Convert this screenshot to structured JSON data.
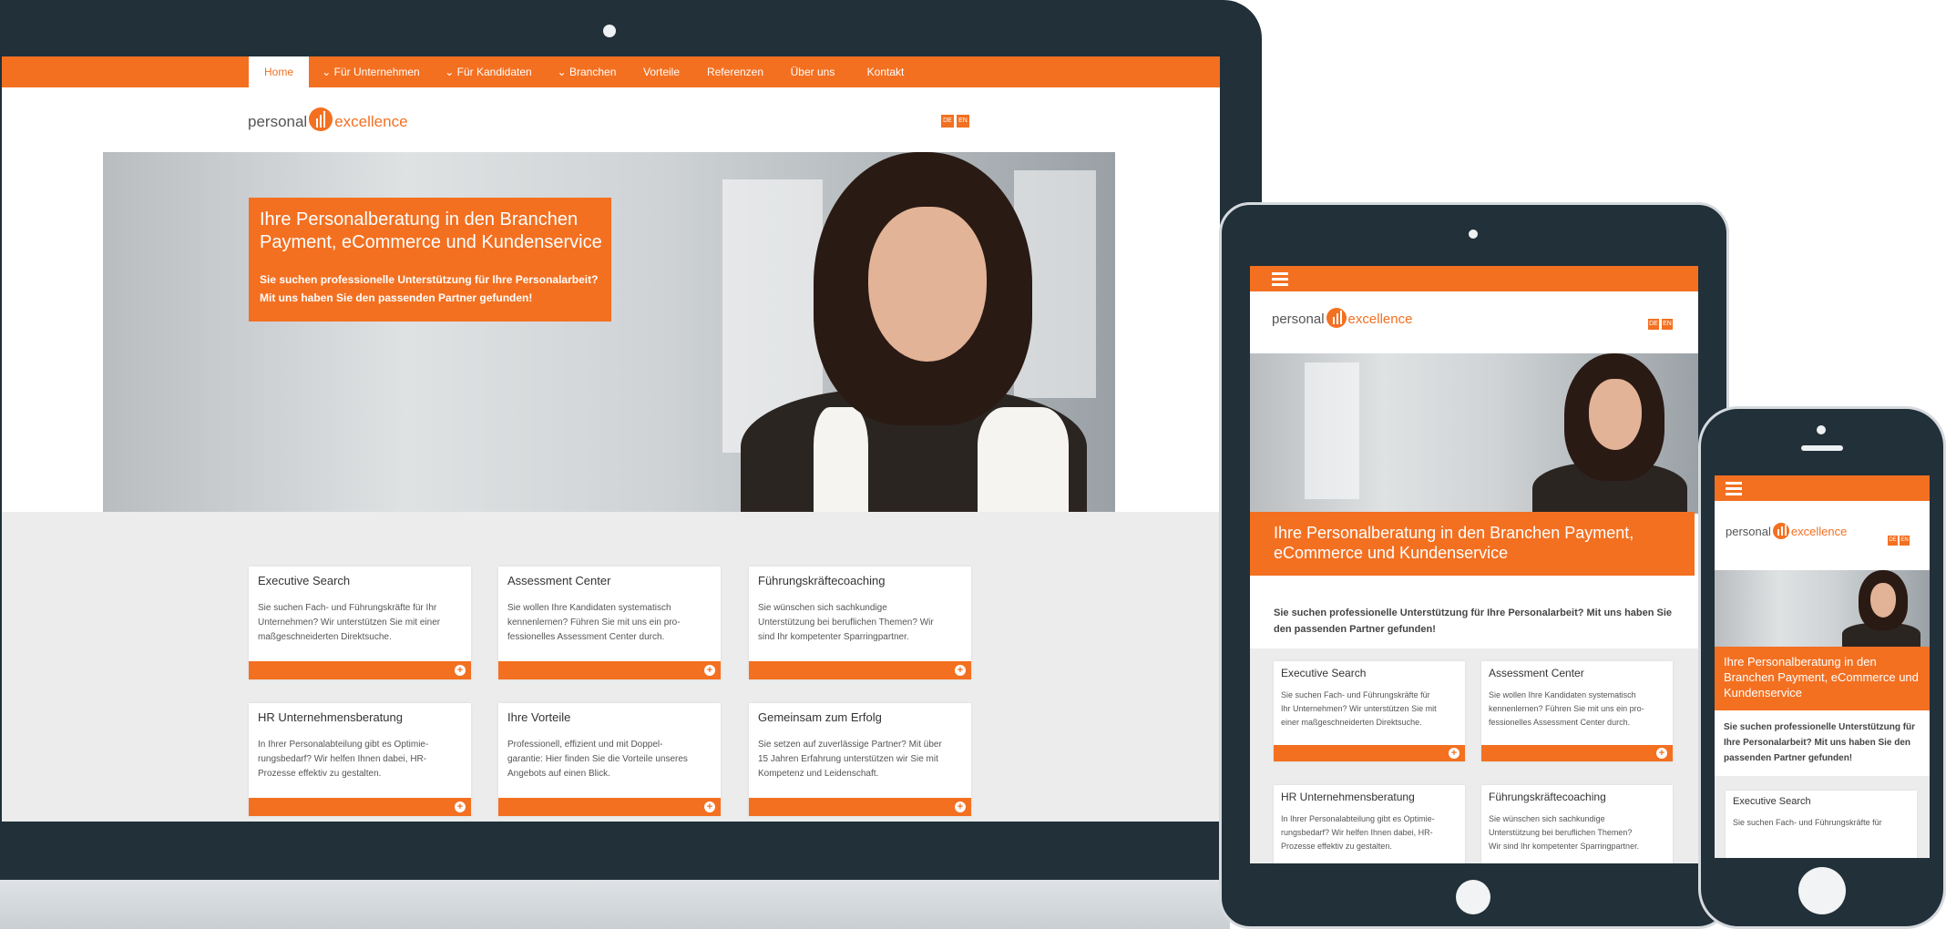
{
  "brand": {
    "part1": "personal",
    "part2": "excellence"
  },
  "languages": [
    "DE",
    "EN"
  ],
  "nav": [
    "Home",
    "Für Unternehmen",
    "Für Kandidaten",
    "Branchen",
    "Vorteile",
    "Referenzen",
    "Über uns",
    "Kontakt"
  ],
  "nav_dropdown_flags": [
    false,
    true,
    true,
    true,
    false,
    false,
    false,
    false
  ],
  "hero": {
    "title_line1": "Ihre Personalberatung in den Branchen",
    "title_line2": "Payment, eCommerce und Kundenservice",
    "title_full": "Ihre Personalberatung in den Branchen Payment, eCommerce und Kundenservice",
    "sub_line1": "Sie suchen professionelle Unterstützung für Ihre Personalarbeit?",
    "sub_line2": "Mit uns haben Sie den passenden Partner gefunden!",
    "sub_full": "Sie suchen professionelle Unterstützung für Ihre Personalarbeit? Mit uns haben Sie den passenden Partner gefunden!"
  },
  "cards": [
    {
      "title": "Executive Search",
      "lines": [
        "Sie suchen Fach- und Führungskräfte für Ihr",
        "Unternehmen? Wir unterstützen Sie mit einer",
        "maßgeschneiderten Direktsuche."
      ]
    },
    {
      "title": "Assessment Center",
      "lines": [
        "Sie wollen Ihre Kandidaten systematisch",
        "kennenlernen? Führen Sie mit uns ein pro-",
        "fessionelles Assessment Center durch."
      ]
    },
    {
      "title": "Führungskräftecoaching",
      "lines": [
        "Sie wünschen sich sachkundige",
        "Unterstützung bei beruflichen Themen? Wir",
        "sind Ihr kompetenter Sparringpartner."
      ]
    },
    {
      "title": "HR Unternehmensberatung",
      "lines": [
        "In Ihrer Personalabteilung gibt es Optimie-",
        "rungsbedarf? Wir helfen Ihnen dabei, HR-",
        "Prozesse effektiv zu gestalten."
      ]
    },
    {
      "title": "Ihre Vorteile",
      "lines": [
        "Professionell, effizient und mit Doppel-",
        "garantie: Hier finden Sie die Vorteile unseres",
        "Angebots auf einen Blick."
      ]
    },
    {
      "title": "Gemeinsam zum Erfolg",
      "lines": [
        "Sie setzen auf zuverlässige Partner? Mit über",
        "15 Jahren Erfahrung unterstützen wir Sie mit",
        "Kompetenz und Leidenschaft."
      ]
    }
  ],
  "tablet_cards": [
    {
      "title": "Executive Search",
      "lines": [
        "Sie suchen Fach- und Führungskräfte für",
        "Ihr Unternehmen? Wir unterstützen Sie mit",
        "einer maßgeschneiderten Direktsuche."
      ]
    },
    {
      "title": "Assessment Center",
      "lines": [
        "Sie wollen Ihre Kandidaten systematisch",
        "kennenlernen? Führen Sie mit uns ein pro-",
        "fessionelles Assessment Center durch."
      ]
    },
    {
      "title": "HR Unternehmensberatung",
      "lines": [
        "In Ihrer Personalabteilung gibt es Optimie-",
        "rungsbedarf? Wir helfen Ihnen dabei, HR-",
        "Prozesse effektiv zu gestalten."
      ]
    },
    {
      "title": "Führungskräftecoaching",
      "lines": [
        "Sie wünschen sich sachkundige",
        "Unterstützung bei beruflichen Themen?",
        "Wir sind Ihr kompetenter Sparringpartner."
      ]
    }
  ],
  "phone_card": {
    "title": "Executive Search",
    "line1": "Sie suchen Fach- und Führungskräfte für"
  },
  "colors": {
    "accent": "#f37021",
    "frame": "#213039",
    "band": "#ececec"
  }
}
